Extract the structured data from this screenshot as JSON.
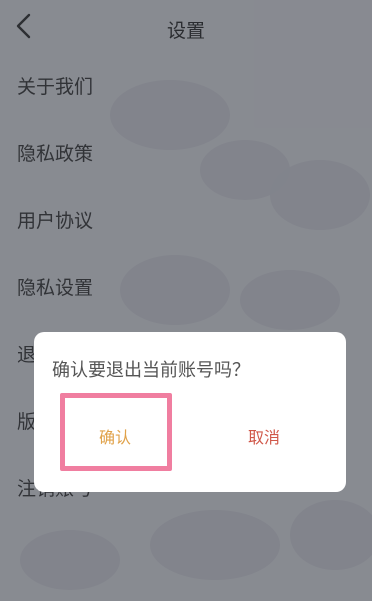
{
  "header": {
    "title": "设置",
    "back_icon": "chevron-left-icon"
  },
  "menu": {
    "items": [
      {
        "label": "关于我们"
      },
      {
        "label": "隐私政策"
      },
      {
        "label": "用户协议"
      },
      {
        "label": "隐私设置"
      },
      {
        "label": "退出登录"
      },
      {
        "label": "版本号"
      },
      {
        "label": "注销账号"
      }
    ]
  },
  "dialog": {
    "message": "确认要退出当前账号吗？",
    "confirm_label": "确认",
    "cancel_label": "取消"
  },
  "colors": {
    "confirm": "#e0a24a",
    "cancel": "#d0584a",
    "highlight": "#f07ea0"
  }
}
